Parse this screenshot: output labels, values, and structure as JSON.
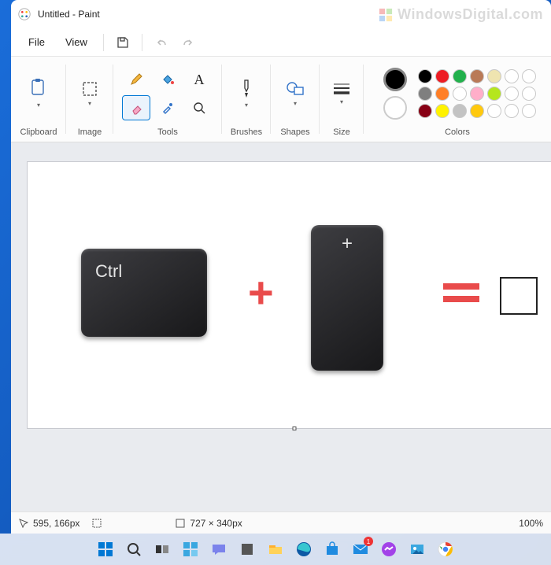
{
  "window": {
    "title": "Untitled - Paint"
  },
  "watermark": "WindowsDigital.com",
  "menubar": {
    "file": "File",
    "view": "View"
  },
  "ribbon": {
    "clipboard": "Clipboard",
    "image": "Image",
    "tools": "Tools",
    "brushes": "Brushes",
    "shapes": "Shapes",
    "size": "Size",
    "colors": "Colors"
  },
  "palette": {
    "primary": "#000000",
    "secondary": "#ffffff",
    "row1": [
      "#000000",
      "#7f7f7f",
      "#880015",
      "#ed1c24",
      "#ff7f27",
      "#fff200",
      "#22b14c"
    ],
    "row2": [
      "#ffffff",
      "#c3c3c3",
      "#b97a57",
      "#ffaec9",
      "#ffc90e",
      "#efe4b0",
      "#b5e61d"
    ],
    "row3": [
      "#ffffff",
      "#ffffff",
      "#ffffff",
      "#ffffff",
      "#ffffff",
      "#ffffff",
      "#ffffff"
    ]
  },
  "canvas": {
    "ctrl_label": "Ctrl",
    "plus_label": "+",
    "plus_sym": "+"
  },
  "status": {
    "cursor": "595, 166px",
    "dim": "727 × 340px",
    "zoom": "100%"
  },
  "taskbar_icons": [
    "start",
    "search",
    "task-view",
    "widgets",
    "chat",
    "explorer-alt",
    "file-explorer",
    "edge",
    "microsoft-store",
    "mail",
    "messenger",
    "photos",
    "chrome"
  ]
}
